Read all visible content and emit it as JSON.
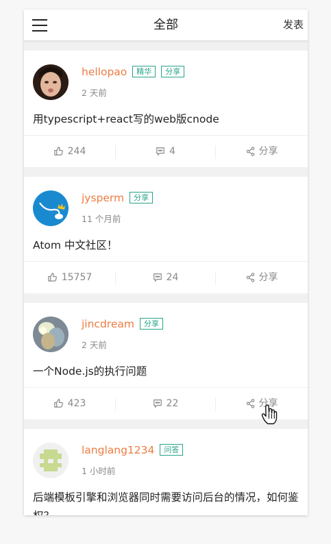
{
  "header": {
    "title": "全部",
    "post_label": "发表"
  },
  "posts": [
    {
      "author": "hellopao",
      "tags": [
        "精华",
        "分享"
      ],
      "time": "2 天前",
      "title": "用typescript+react写的web版cnode",
      "likes": "244",
      "comments": "4",
      "share": "分享"
    },
    {
      "author": "jysperm",
      "tags": [
        "分享"
      ],
      "time": "11 个月前",
      "title": "Atom 中文社区！",
      "likes": "15757",
      "comments": "24",
      "share": "分享"
    },
    {
      "author": "jincdream",
      "tags": [
        "分享"
      ],
      "time": "2 天前",
      "title": "一个Node.js的执行问题",
      "likes": "423",
      "comments": "22",
      "share": "分享"
    },
    {
      "author": "langlang1234",
      "tags": [
        "问答"
      ],
      "time": "1 小时前",
      "title": "后端模板引擎和浏览器同时需要访问后台的情况，如何鉴权？"
    }
  ]
}
